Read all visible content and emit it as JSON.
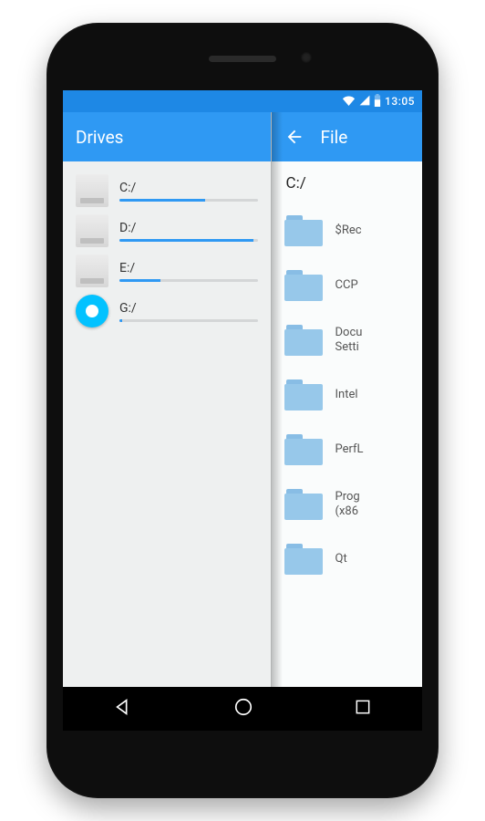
{
  "status": {
    "time": "13:05"
  },
  "left": {
    "title": "Drives",
    "drives": [
      {
        "label": "C:/",
        "usage": 62,
        "type": "hdd"
      },
      {
        "label": "D:/",
        "usage": 97,
        "type": "hdd"
      },
      {
        "label": "E:/",
        "usage": 30,
        "type": "hdd"
      },
      {
        "label": "G:/",
        "usage": 2,
        "type": "optical"
      }
    ]
  },
  "right": {
    "title": "File",
    "path": "C:/",
    "items": [
      {
        "name": "$Rec"
      },
      {
        "name": "CCP"
      },
      {
        "name": "Docu\nSetti"
      },
      {
        "name": "Intel"
      },
      {
        "name": "PerfL"
      },
      {
        "name": "Prog\n(x86"
      },
      {
        "name": "Qt"
      }
    ]
  }
}
